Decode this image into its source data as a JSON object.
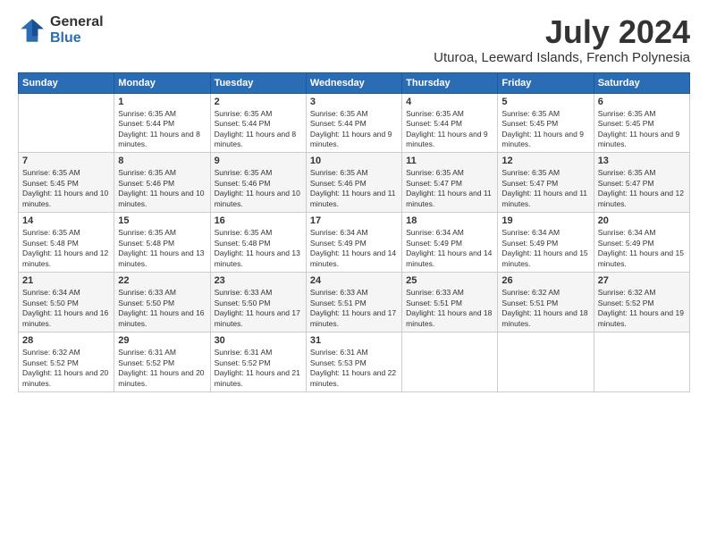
{
  "logo": {
    "general": "General",
    "blue": "Blue"
  },
  "title": "July 2024",
  "location": "Uturoa, Leeward Islands, French Polynesia",
  "headers": [
    "Sunday",
    "Monday",
    "Tuesday",
    "Wednesday",
    "Thursday",
    "Friday",
    "Saturday"
  ],
  "weeks": [
    [
      {
        "day": "",
        "sunrise": "",
        "sunset": "",
        "daylight": ""
      },
      {
        "day": "1",
        "sunrise": "Sunrise: 6:35 AM",
        "sunset": "Sunset: 5:44 PM",
        "daylight": "Daylight: 11 hours and 8 minutes."
      },
      {
        "day": "2",
        "sunrise": "Sunrise: 6:35 AM",
        "sunset": "Sunset: 5:44 PM",
        "daylight": "Daylight: 11 hours and 8 minutes."
      },
      {
        "day": "3",
        "sunrise": "Sunrise: 6:35 AM",
        "sunset": "Sunset: 5:44 PM",
        "daylight": "Daylight: 11 hours and 9 minutes."
      },
      {
        "day": "4",
        "sunrise": "Sunrise: 6:35 AM",
        "sunset": "Sunset: 5:44 PM",
        "daylight": "Daylight: 11 hours and 9 minutes."
      },
      {
        "day": "5",
        "sunrise": "Sunrise: 6:35 AM",
        "sunset": "Sunset: 5:45 PM",
        "daylight": "Daylight: 11 hours and 9 minutes."
      },
      {
        "day": "6",
        "sunrise": "Sunrise: 6:35 AM",
        "sunset": "Sunset: 5:45 PM",
        "daylight": "Daylight: 11 hours and 9 minutes."
      }
    ],
    [
      {
        "day": "7",
        "sunrise": "Sunrise: 6:35 AM",
        "sunset": "Sunset: 5:45 PM",
        "daylight": "Daylight: 11 hours and 10 minutes."
      },
      {
        "day": "8",
        "sunrise": "Sunrise: 6:35 AM",
        "sunset": "Sunset: 5:46 PM",
        "daylight": "Daylight: 11 hours and 10 minutes."
      },
      {
        "day": "9",
        "sunrise": "Sunrise: 6:35 AM",
        "sunset": "Sunset: 5:46 PM",
        "daylight": "Daylight: 11 hours and 10 minutes."
      },
      {
        "day": "10",
        "sunrise": "Sunrise: 6:35 AM",
        "sunset": "Sunset: 5:46 PM",
        "daylight": "Daylight: 11 hours and 11 minutes."
      },
      {
        "day": "11",
        "sunrise": "Sunrise: 6:35 AM",
        "sunset": "Sunset: 5:47 PM",
        "daylight": "Daylight: 11 hours and 11 minutes."
      },
      {
        "day": "12",
        "sunrise": "Sunrise: 6:35 AM",
        "sunset": "Sunset: 5:47 PM",
        "daylight": "Daylight: 11 hours and 11 minutes."
      },
      {
        "day": "13",
        "sunrise": "Sunrise: 6:35 AM",
        "sunset": "Sunset: 5:47 PM",
        "daylight": "Daylight: 11 hours and 12 minutes."
      }
    ],
    [
      {
        "day": "14",
        "sunrise": "Sunrise: 6:35 AM",
        "sunset": "Sunset: 5:48 PM",
        "daylight": "Daylight: 11 hours and 12 minutes."
      },
      {
        "day": "15",
        "sunrise": "Sunrise: 6:35 AM",
        "sunset": "Sunset: 5:48 PM",
        "daylight": "Daylight: 11 hours and 13 minutes."
      },
      {
        "day": "16",
        "sunrise": "Sunrise: 6:35 AM",
        "sunset": "Sunset: 5:48 PM",
        "daylight": "Daylight: 11 hours and 13 minutes."
      },
      {
        "day": "17",
        "sunrise": "Sunrise: 6:34 AM",
        "sunset": "Sunset: 5:49 PM",
        "daylight": "Daylight: 11 hours and 14 minutes."
      },
      {
        "day": "18",
        "sunrise": "Sunrise: 6:34 AM",
        "sunset": "Sunset: 5:49 PM",
        "daylight": "Daylight: 11 hours and 14 minutes."
      },
      {
        "day": "19",
        "sunrise": "Sunrise: 6:34 AM",
        "sunset": "Sunset: 5:49 PM",
        "daylight": "Daylight: 11 hours and 15 minutes."
      },
      {
        "day": "20",
        "sunrise": "Sunrise: 6:34 AM",
        "sunset": "Sunset: 5:49 PM",
        "daylight": "Daylight: 11 hours and 15 minutes."
      }
    ],
    [
      {
        "day": "21",
        "sunrise": "Sunrise: 6:34 AM",
        "sunset": "Sunset: 5:50 PM",
        "daylight": "Daylight: 11 hours and 16 minutes."
      },
      {
        "day": "22",
        "sunrise": "Sunrise: 6:33 AM",
        "sunset": "Sunset: 5:50 PM",
        "daylight": "Daylight: 11 hours and 16 minutes."
      },
      {
        "day": "23",
        "sunrise": "Sunrise: 6:33 AM",
        "sunset": "Sunset: 5:50 PM",
        "daylight": "Daylight: 11 hours and 17 minutes."
      },
      {
        "day": "24",
        "sunrise": "Sunrise: 6:33 AM",
        "sunset": "Sunset: 5:51 PM",
        "daylight": "Daylight: 11 hours and 17 minutes."
      },
      {
        "day": "25",
        "sunrise": "Sunrise: 6:33 AM",
        "sunset": "Sunset: 5:51 PM",
        "daylight": "Daylight: 11 hours and 18 minutes."
      },
      {
        "day": "26",
        "sunrise": "Sunrise: 6:32 AM",
        "sunset": "Sunset: 5:51 PM",
        "daylight": "Daylight: 11 hours and 18 minutes."
      },
      {
        "day": "27",
        "sunrise": "Sunrise: 6:32 AM",
        "sunset": "Sunset: 5:52 PM",
        "daylight": "Daylight: 11 hours and 19 minutes."
      }
    ],
    [
      {
        "day": "28",
        "sunrise": "Sunrise: 6:32 AM",
        "sunset": "Sunset: 5:52 PM",
        "daylight": "Daylight: 11 hours and 20 minutes."
      },
      {
        "day": "29",
        "sunrise": "Sunrise: 6:31 AM",
        "sunset": "Sunset: 5:52 PM",
        "daylight": "Daylight: 11 hours and 20 minutes."
      },
      {
        "day": "30",
        "sunrise": "Sunrise: 6:31 AM",
        "sunset": "Sunset: 5:52 PM",
        "daylight": "Daylight: 11 hours and 21 minutes."
      },
      {
        "day": "31",
        "sunrise": "Sunrise: 6:31 AM",
        "sunset": "Sunset: 5:53 PM",
        "daylight": "Daylight: 11 hours and 22 minutes."
      },
      {
        "day": "",
        "sunrise": "",
        "sunset": "",
        "daylight": ""
      },
      {
        "day": "",
        "sunrise": "",
        "sunset": "",
        "daylight": ""
      },
      {
        "day": "",
        "sunrise": "",
        "sunset": "",
        "daylight": ""
      }
    ]
  ]
}
